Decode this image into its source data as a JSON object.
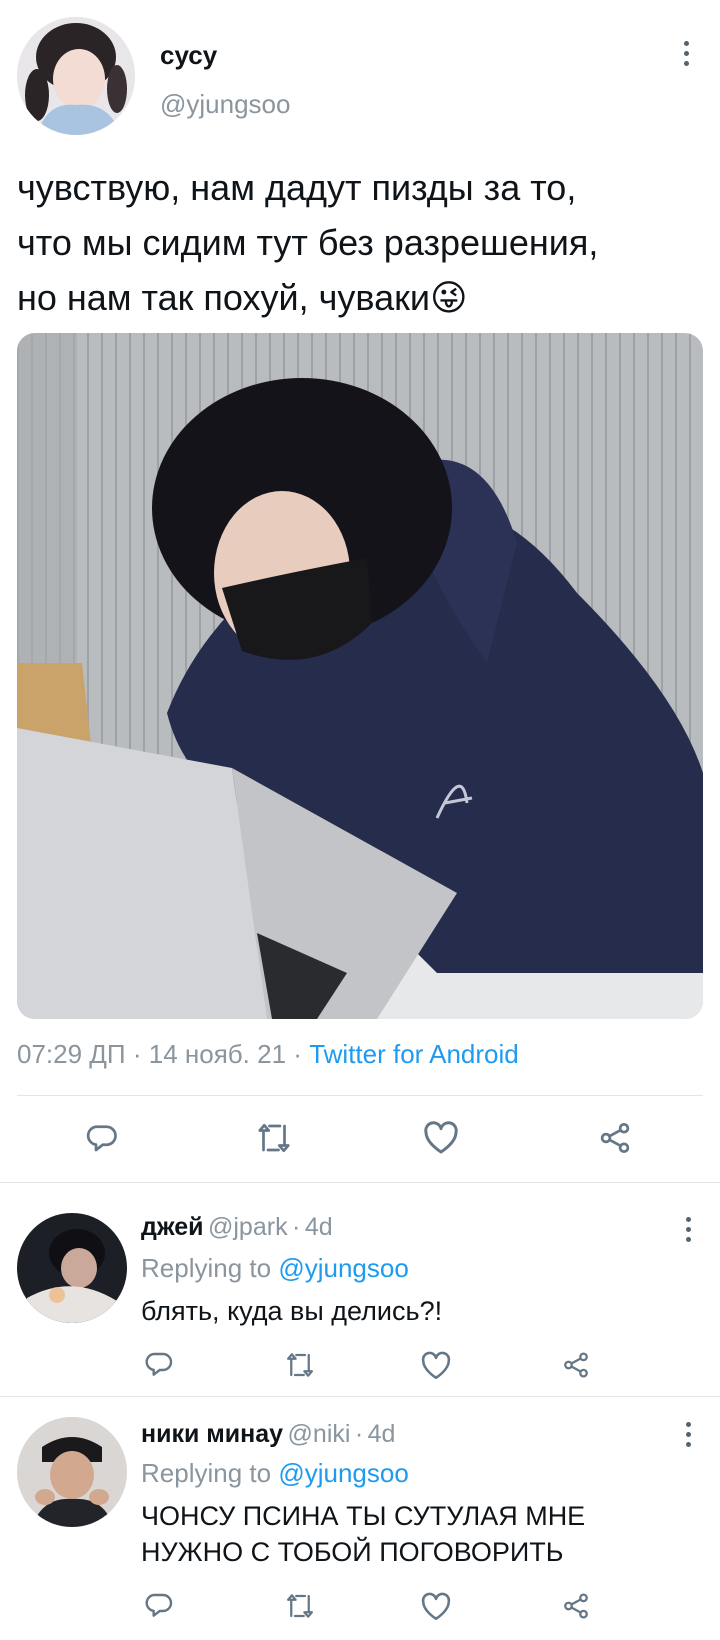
{
  "tweet": {
    "author_name": "сусу",
    "author_handle": "@yjungsoo",
    "text_lines": [
      "чувствую, нам дадут пизды за то,",
      "что мы сидим тут без разрешения,",
      "но нам так похуй, чуваки"
    ],
    "emoji": "😜",
    "time": "07:29 ДП",
    "separator": "·",
    "date": "14 нояб. 21",
    "client": "Twitter for Android"
  },
  "replies": [
    {
      "name": "джей",
      "handle": "@jpark",
      "dot": "·",
      "age": "4d",
      "replying_prefix": "Replying to",
      "replying_handle": "@yjungsoo",
      "text_lines": [
        "блять, куда вы делись?!"
      ]
    },
    {
      "name": "ники минау",
      "handle": "@niki",
      "dot": "·",
      "age": "4d",
      "replying_prefix": "Replying to",
      "replying_handle": "@yjungsoo",
      "text_lines": [
        "ЧОНСУ ПСИНА ТЫ СУТУЛАЯ МНЕ",
        "НУЖНО С ТОБОЙ ПОГОВОРИТЬ"
      ]
    }
  ],
  "icons": {
    "reply": "reply-icon",
    "retweet": "retweet-icon",
    "like": "heart-icon",
    "share": "share-icon",
    "more": "more-vertical-icon"
  },
  "colors": {
    "link": "#1d9bf0",
    "text": "#0f1419",
    "muted": "#8a959e",
    "icon": "#657786"
  }
}
